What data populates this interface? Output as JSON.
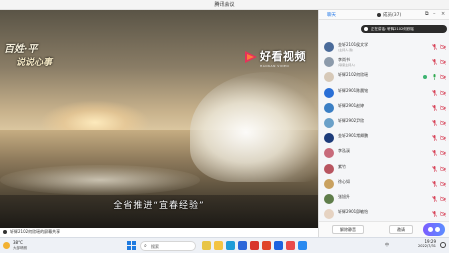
{
  "app": {
    "title": "腾讯会议"
  },
  "video": {
    "show_logo_line1": "百姓·平",
    "show_logo_line2": "说说心事",
    "channel_logo": "好看视频",
    "channel_logo_small": "HAOKAN VIDEO",
    "subtitle": "全省推进“宜春经验”"
  },
  "share_bar": {
    "label": "轩辉2102何欣瑶的屏幕共享"
  },
  "panel": {
    "tabs": {
      "chat": "聊天",
      "members": "成员(37)"
    },
    "notice": "正在讲话: 轩辉2102何欣瑶",
    "members": [
      {
        "name": "金轩2101侯文学",
        "sub": "(主持人,我)",
        "avatar": "#4a6b9a",
        "mic": "muted",
        "cam": "off"
      },
      {
        "name": "李尚书",
        "sub": "(联席主持人)",
        "avatar": "#8c9aaa",
        "mic": "muted",
        "cam": "off"
      },
      {
        "name": "轩辉2102何欣瑶",
        "sub": "",
        "avatar": "#d7c9b8",
        "mic": "on",
        "cam": "off",
        "share": true
      },
      {
        "name": "轩辉2901陈晨铭",
        "sub": "",
        "avatar": "#2a6fd6",
        "mic": "muted",
        "cam": "off"
      },
      {
        "name": "轩辉2901赵婷",
        "sub": "",
        "avatar": "#3b7fc4",
        "mic": "muted",
        "cam": "off"
      },
      {
        "name": "轩辉2902尹欣",
        "sub": "",
        "avatar": "#6aa0c8",
        "mic": "muted",
        "cam": "off"
      },
      {
        "name": "金轩2901常卿鹏",
        "sub": "",
        "avatar": "#1d3c7a",
        "mic": "muted",
        "cam": "off"
      },
      {
        "name": "李泓溪",
        "sub": "",
        "avatar": "#c86b7b",
        "mic": "muted",
        "cam": "off"
      },
      {
        "name": "紫竹",
        "sub": "",
        "avatar": "#b85560",
        "mic": "muted",
        "cam": "off"
      },
      {
        "name": "徐心如",
        "sub": "",
        "avatar": "#c9a15f",
        "mic": "muted",
        "cam": "off"
      },
      {
        "name": "张旭升",
        "sub": "",
        "avatar": "#5f7d4a",
        "mic": "muted",
        "cam": "off"
      },
      {
        "name": "轩辉2901邱敏怡",
        "sub": "",
        "avatar": "#e6d3c2",
        "mic": "muted",
        "cam": "off"
      }
    ],
    "bottom": {
      "unmute_all": "解除静音",
      "invite": "邀请",
      "assistant_label": "会议助手"
    }
  },
  "taskbar": {
    "weather_temp": "38°C",
    "weather_cond": "大部晴朗",
    "search_placeholder": "搜索",
    "apps": [
      {
        "name": "copilot-icon",
        "color": "#e8c547"
      },
      {
        "name": "file-explorer-icon",
        "color": "#f3c443"
      },
      {
        "name": "edge-icon",
        "color": "#1f9cd8"
      },
      {
        "name": "store-icon",
        "color": "#2b66d9"
      },
      {
        "name": "wps-icon",
        "color": "#d8342c"
      },
      {
        "name": "red-app-icon",
        "color": "#e0452a"
      },
      {
        "name": "tencent-meeting-icon",
        "color": "#1c62e0"
      },
      {
        "name": "music-app-icon",
        "color": "#e94b4b"
      },
      {
        "name": "blue-app-icon",
        "color": "#2a8af0"
      }
    ],
    "tray_text": "中",
    "time": "19:29",
    "date": "2022/7/31"
  }
}
